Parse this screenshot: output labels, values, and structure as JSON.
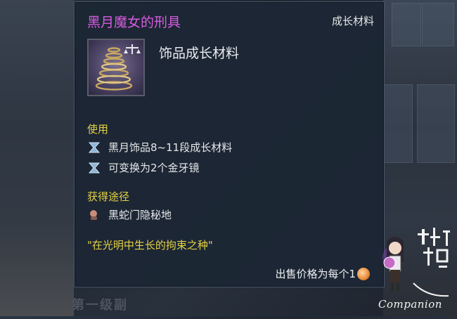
{
  "tooltip": {
    "title": "黑月魔女的刑具",
    "category": "成长材料",
    "subtitle": "饰品成长材料",
    "usage_label": "使用",
    "usage_lines": [
      "黑月饰品8~11段成长材料",
      "可变换为2个金牙镜"
    ],
    "source_label": "获得途径",
    "source_lines": [
      "黑蛇门隐秘地"
    ],
    "flavor_text": "\"在光明中生长的拘束之种\"",
    "price_text": "出售价格为每个1",
    "title_color": "#d65ce0",
    "section_color": "#e4d244"
  },
  "background": {
    "bottom_text": "第一级副"
  },
  "watermark": {
    "text": "Companion"
  }
}
